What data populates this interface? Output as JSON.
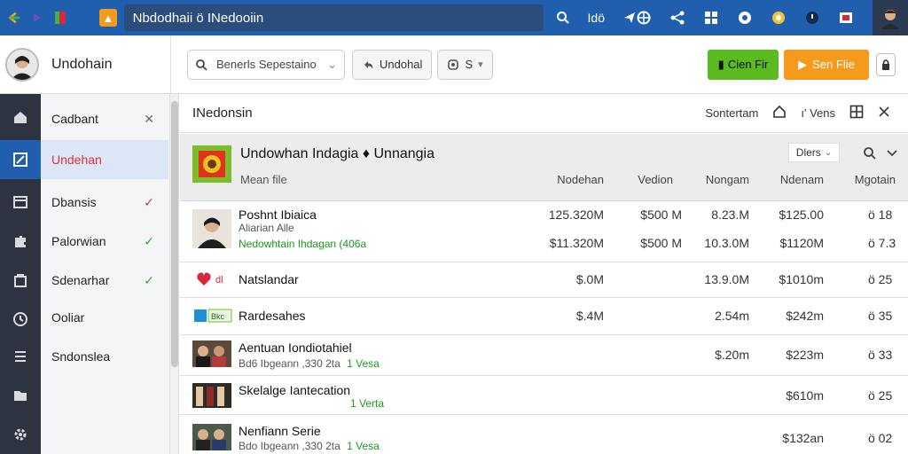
{
  "topbar": {
    "window_title": "Nbdodhaii ö INedooiin",
    "tool_text": "Idö"
  },
  "header": {
    "user_name": "Undohain",
    "search_placeholder": "Benerls Sepestaino",
    "search_caret": "⌄",
    "ghost_button_label": "Undohal",
    "select_value": "S",
    "green_button_label": "Cien Fir",
    "orange_button_label": "Sen Flie"
  },
  "sidebar": {
    "items": [
      {
        "label": "Cadbant",
        "mark": "✕",
        "mark_color": "#666"
      },
      {
        "label": "Undehan",
        "mark": "",
        "mark_color": ""
      },
      {
        "label": "Dbansis",
        "mark": "✓",
        "mark_color": "#d33"
      },
      {
        "label": "Palorwian",
        "mark": "✓",
        "mark_color": "#3aa83a"
      },
      {
        "label": "Sdenarhar",
        "mark": "✓",
        "mark_color": "#3aa83a"
      },
      {
        "label": "Ooliar",
        "mark": "",
        "mark_color": ""
      },
      {
        "label": "Sndonslea",
        "mark": "",
        "mark_color": ""
      }
    ]
  },
  "main": {
    "title": "INedonsin",
    "sort_label": "Sontertam",
    "view_label": "Vens",
    "group": {
      "title": "Undowhan Indagia ♦ Unnangia",
      "subtitle": "Mean file",
      "filter_label": "Dlers",
      "columns": [
        "Nodehan",
        "Vedion",
        "Nongam",
        "Ndenam",
        "Mgotain"
      ]
    },
    "rows": [
      {
        "name": "Poshnt Ibiaica",
        "sub1": "Aliarian Alle",
        "sub2": "Nedowhtain Ihdagan (406a",
        "vals_top": [
          "125.320M",
          "$500 M",
          "8.23.M",
          "$125.00"
        ],
        "vals_bot": [
          "$11.320M",
          "$500 M",
          "10.3.0M",
          "$1120M"
        ],
        "rank_top": "ö 18",
        "rank_bot": "ö 7.3"
      },
      {
        "name": "Natslandar",
        "vals": [
          "$.0M",
          "",
          "13.9.0M",
          "$1010m"
        ],
        "rank": "ö 25"
      },
      {
        "name": "Rardesahes",
        "vals": [
          "$.4M",
          "",
          "2.54m",
          "$242m"
        ],
        "rank": "ö 35"
      },
      {
        "name": "Aentuan Iondiotahiel",
        "sub": "Bd6 Ibgeann ,330 2ta",
        "tag": "1 Vesa",
        "vals": [
          "",
          "",
          "$.20m",
          "$223m"
        ],
        "rank": "ö 33"
      },
      {
        "name": "Skelalge Iantecation",
        "tag": "1 Verta",
        "vals": [
          "",
          "",
          "",
          "$610m"
        ],
        "rank": "ö 25"
      },
      {
        "name": "Nenfiann Serie",
        "sub": "Bdo Ibgeann ,330 2ta",
        "tag": "1 Vesa",
        "vals": [
          "",
          "",
          "",
          "$132an"
        ],
        "rank": "ö 02"
      }
    ]
  },
  "colors": {
    "topbar": "#1f5fae",
    "rail": "#2d3340",
    "green_button": "#5aba1f",
    "orange_button": "#f49a1c"
  }
}
